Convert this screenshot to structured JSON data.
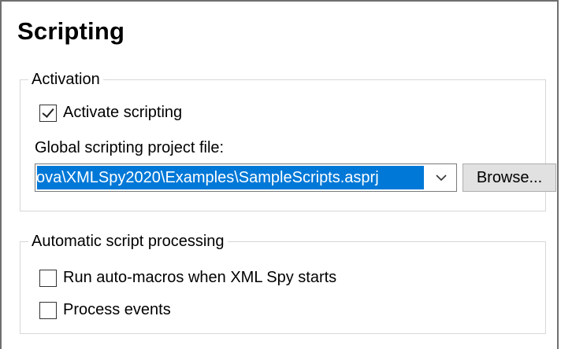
{
  "panel": {
    "title": "Scripting"
  },
  "activation": {
    "legend": "Activation",
    "activate_label": "Activate scripting",
    "activate_checked": true,
    "project_file_label": "Global scripting project file:",
    "project_file_value": "ova\\XMLSpy2020\\Examples\\SampleScripts.asprj",
    "browse_label": "Browse..."
  },
  "automatic": {
    "legend": "Automatic script processing",
    "run_macros_label": "Run auto-macros when XML Spy starts",
    "run_macros_checked": false,
    "process_events_label": "Process events",
    "process_events_checked": false
  },
  "icons": {
    "combo_arrow": "chevron-down-icon",
    "checkmark": "checkmark-icon"
  },
  "colors": {
    "selection": "#0078d7",
    "button_bg": "#e1e1e1"
  }
}
